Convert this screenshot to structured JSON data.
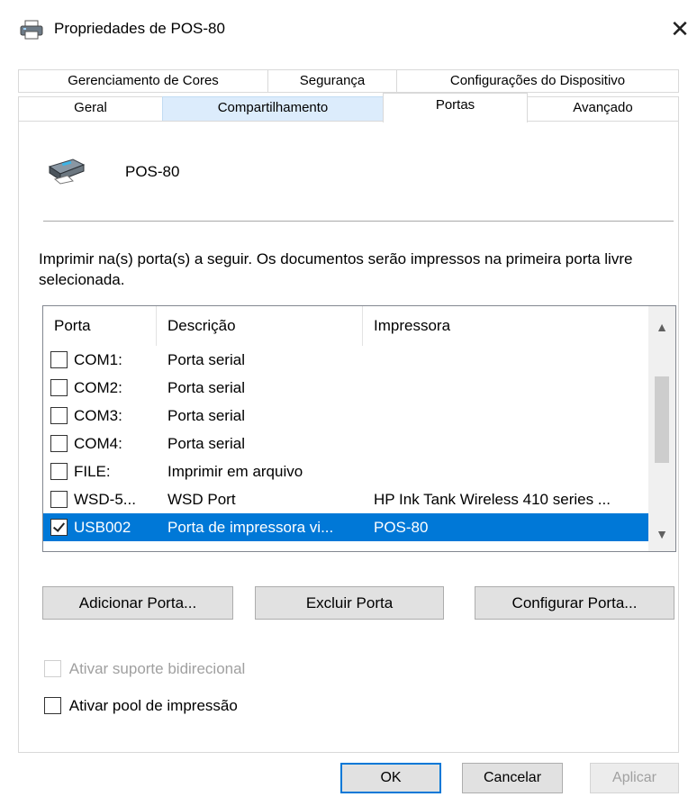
{
  "window": {
    "title": "Propriedades de POS-80"
  },
  "tabs_row1": [
    "Gerenciamento de Cores",
    "Segurança",
    "Configurações do Dispositivo"
  ],
  "tabs_row2": [
    "Geral",
    "Compartilhamento",
    "Portas",
    "Avançado"
  ],
  "printer": {
    "name": "POS-80"
  },
  "instructions": "Imprimir na(s) porta(s) a seguir. Os documentos serão impressos na primeira porta livre selecionada.",
  "ports_table": {
    "headers": [
      "Porta",
      "Descrição",
      "Impressora"
    ],
    "rows": [
      {
        "port": "COM1:",
        "description": "Porta serial",
        "printer": "",
        "checked": false
      },
      {
        "port": "COM2:",
        "description": "Porta serial",
        "printer": "",
        "checked": false
      },
      {
        "port": "COM3:",
        "description": "Porta serial",
        "printer": "",
        "checked": false
      },
      {
        "port": "COM4:",
        "description": "Porta serial",
        "printer": "",
        "checked": false
      },
      {
        "port": "FILE:",
        "description": "Imprimir em arquivo",
        "printer": "",
        "checked": false
      },
      {
        "port": "WSD-5...",
        "description": "WSD Port",
        "printer": "HP Ink Tank Wireless 410 series ...",
        "checked": false
      },
      {
        "port": "USB002",
        "description": "Porta de impressora vi...",
        "printer": "POS-80",
        "checked": true
      }
    ]
  },
  "buttons": {
    "add_port": "Adicionar Porta...",
    "delete_port": "Excluir Porta",
    "configure_port": "Configurar Porta..."
  },
  "options": {
    "bidirectional": {
      "label": "Ativar suporte bidirecional",
      "checked": false,
      "enabled": false
    },
    "pooling": {
      "label": "Ativar pool de impressão",
      "checked": false,
      "enabled": true
    }
  },
  "footer": {
    "ok": "OK",
    "cancel": "Cancelar",
    "apply": "Aplicar"
  },
  "colors": {
    "selection": "#0078d7",
    "tab_hover": "#dcecfc"
  }
}
